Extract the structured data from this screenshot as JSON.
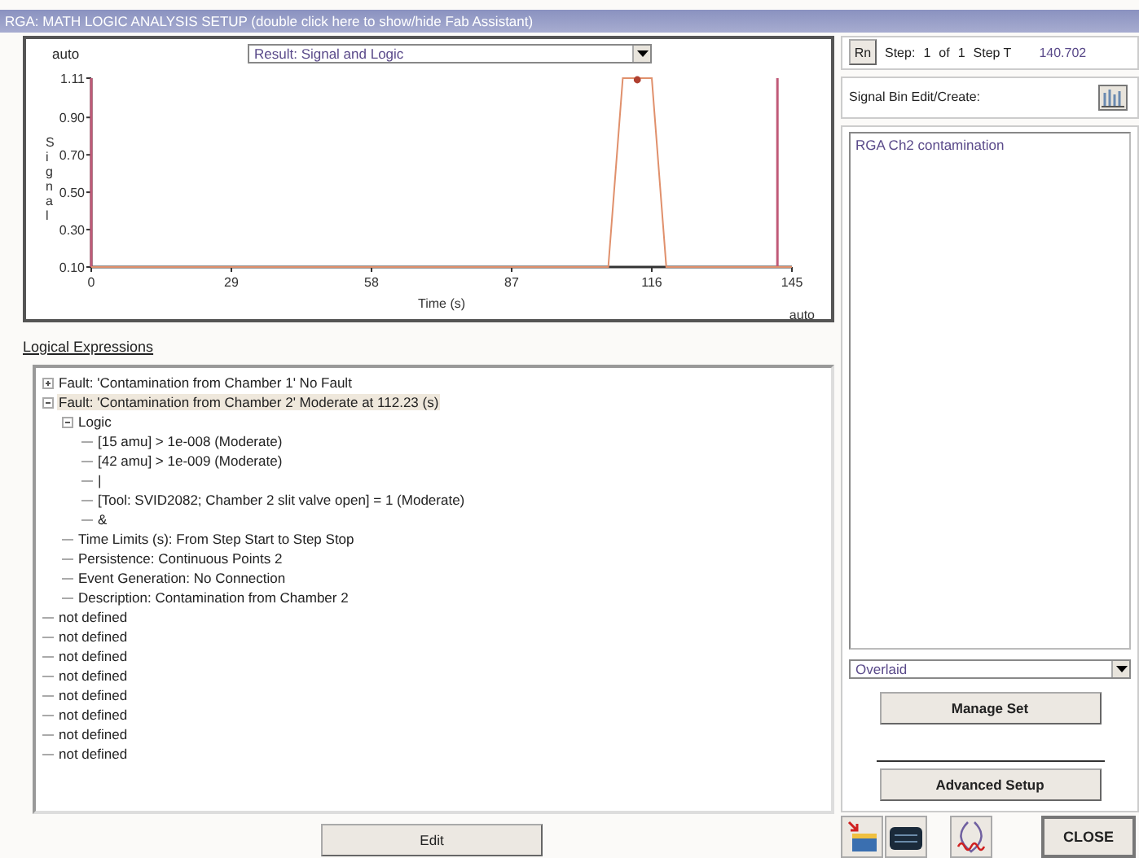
{
  "window": {
    "title": "RGA: MATH LOGIC ANALYSIS SETUP (double click here to show/hide Fab Assistant)"
  },
  "chart": {
    "dropdown": "Result: Signal and Logic",
    "y_auto": "auto",
    "x_auto": "auto",
    "chart_data": {
      "type": "line",
      "xlabel": "Time (s)",
      "ylabel": "Signal",
      "x": [
        0,
        107,
        110,
        116,
        119,
        145
      ],
      "ref_lines": [
        {
          "axis": "x",
          "value": 0,
          "color": "#c05a78"
        },
        {
          "axis": "x",
          "value": 142,
          "color": "#c05a78"
        }
      ],
      "series": [
        {
          "color": "#e0906c",
          "values": [
            0.1,
            0.1,
            1.11,
            1.11,
            0.1,
            0.1
          ]
        }
      ],
      "xlim": [
        0,
        145
      ],
      "ylim": [
        0.1,
        1.11
      ],
      "xticks": [
        0,
        29,
        58,
        87,
        116,
        145
      ],
      "yticks": [
        {
          "value": 0.1,
          "label": "0.10"
        },
        {
          "value": 0.3,
          "label": "0.30"
        },
        {
          "value": 0.5,
          "label": "0.50"
        },
        {
          "value": 0.7,
          "label": "0.70"
        },
        {
          "value": 0.9,
          "label": "0.90"
        },
        {
          "value": 1.11,
          "label": "1.11"
        }
      ]
    }
  },
  "logical_expressions": {
    "heading": "Logical Expressions",
    "tree": [
      {
        "label": "Fault: 'Contamination from Chamber 1' No Fault",
        "expanded": false,
        "selected": false
      },
      {
        "label": "Fault: 'Contamination from Chamber 2' Moderate at 112.23 (s)",
        "expanded": true,
        "selected": true,
        "children": [
          {
            "label": "Logic",
            "expanded": true,
            "children": [
              {
                "label": "[15 amu] > 1e-008 (Moderate)"
              },
              {
                "label": "[42 amu] > 1e-009 (Moderate)"
              },
              {
                "label": "|"
              },
              {
                "label": "[Tool: SVID2082; Chamber 2 slit valve open] = 1 (Moderate)"
              },
              {
                "label": "&"
              }
            ]
          },
          {
            "label": "Time Limits (s):   From Step Start to Step Stop"
          },
          {
            "label": "Persistence: Continuous Points 2"
          },
          {
            "label": "Event Generation: No Connection"
          },
          {
            "label": "Description: Contamination from Chamber 2"
          }
        ]
      },
      {
        "label": "not defined",
        "selected": false
      },
      {
        "label": "not defined",
        "selected": false
      },
      {
        "label": "not defined",
        "selected": false
      },
      {
        "label": "not defined",
        "selected": false
      },
      {
        "label": "not defined",
        "selected": false
      },
      {
        "label": "not defined",
        "selected": false
      },
      {
        "label": "not defined",
        "selected": false
      },
      {
        "label": "not defined",
        "selected": false
      }
    ]
  },
  "edit_button": "Edit",
  "step_bar": {
    "button": "Rn",
    "step_label": "Step:",
    "step": "1",
    "of": "of",
    "total": "1",
    "step_t_label": "Step T",
    "step_t": "140.702"
  },
  "signal_bin": {
    "label": "Signal Bin Edit/Create:",
    "items": [
      "RGA Ch2 contamination"
    ]
  },
  "view_select": "Overlaid",
  "manage_button": "Manage Set",
  "advanced_button": "Advanced Setup",
  "close_button": "CLOSE"
}
